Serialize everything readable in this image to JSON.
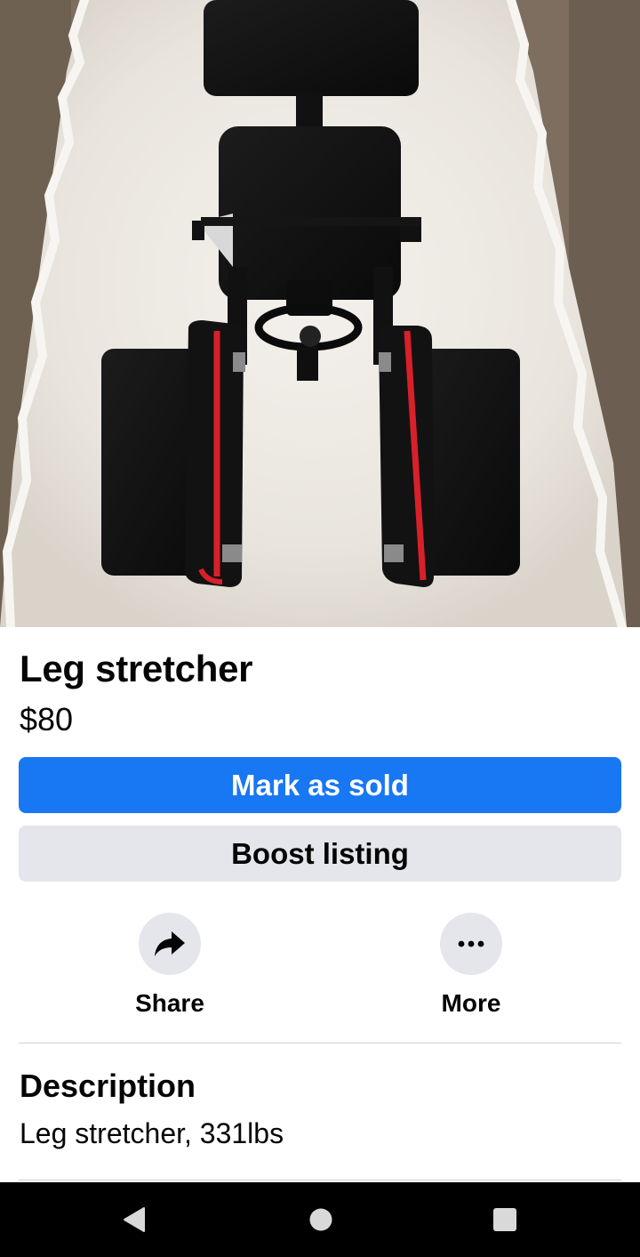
{
  "listing": {
    "title": "Leg stretcher",
    "price": "$80"
  },
  "buttons": {
    "mark_sold_label": "Mark as sold",
    "boost_label": "Boost listing"
  },
  "actions": {
    "share_label": "Share",
    "share_icon": "share-arrow-icon",
    "more_label": "More",
    "more_icon": "ellipsis-icon"
  },
  "description": {
    "heading": "Description",
    "text": "Leg stretcher, 331lbs"
  },
  "nav": {
    "back_icon": "back-triangle-icon",
    "home_icon": "home-circle-icon",
    "recents_icon": "recents-square-icon"
  },
  "colors": {
    "primary": "#1877f2",
    "secondary": "#e4e6eb",
    "text": "#050505",
    "navbar": "#000000"
  }
}
